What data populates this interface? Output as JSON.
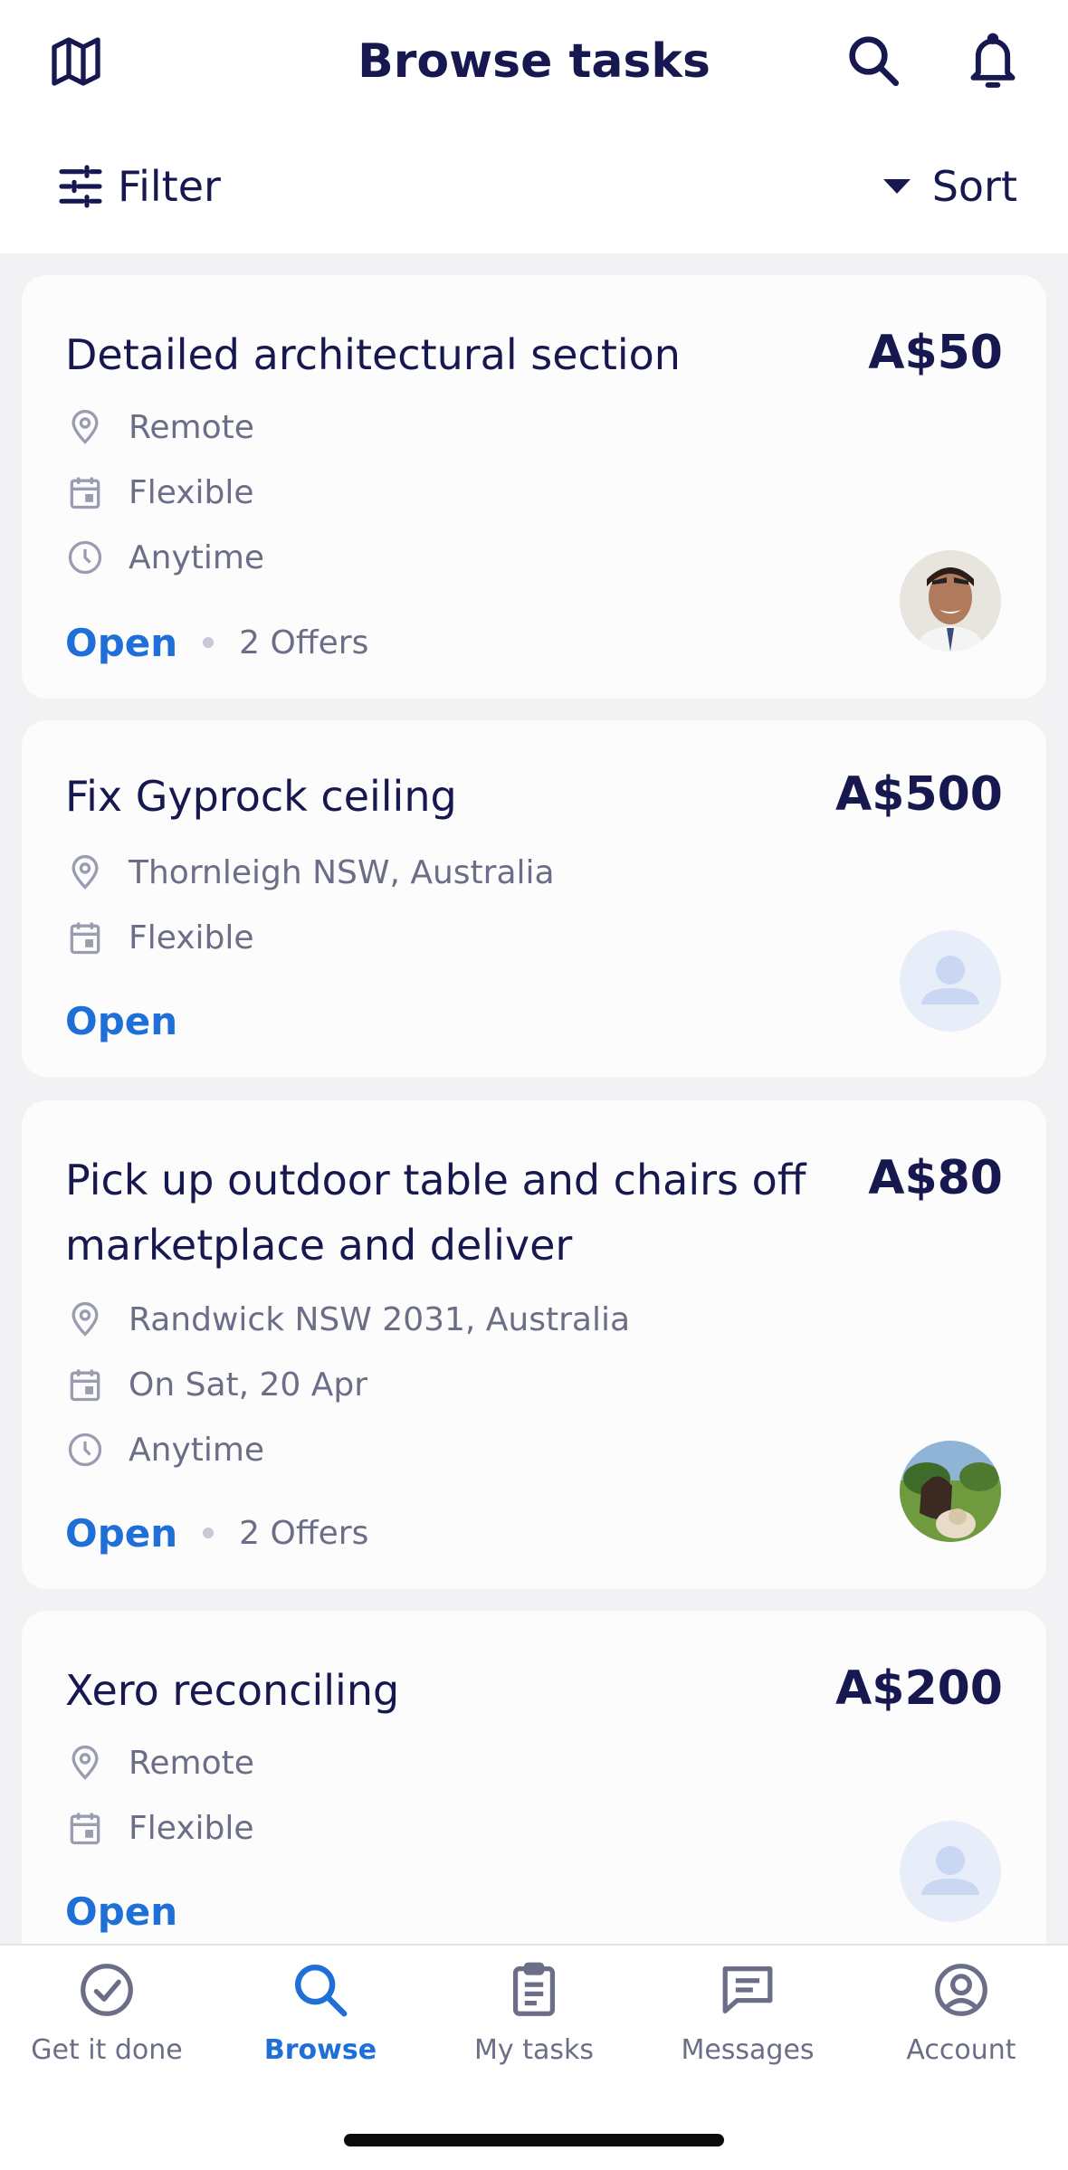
{
  "header": {
    "title": "Browse tasks",
    "filter_label": "Filter",
    "sort_label": "Sort"
  },
  "tasks": [
    {
      "title": "Detailed architectural section",
      "price": "A$50",
      "location": "Remote",
      "date": "Flexible",
      "time": "Anytime",
      "status": "Open",
      "offers": "2 Offers",
      "avatar": "photo"
    },
    {
      "title": "Fix Gyprock ceiling",
      "price": "A$500",
      "location": "Thornleigh NSW, Australia",
      "date": "Flexible",
      "status": "Open",
      "avatar": "placeholder"
    },
    {
      "title": "Pick up outdoor table and chairs off marketplace and deliver",
      "price": "A$80",
      "location": "Randwick NSW 2031, Australia",
      "date": "On Sat, 20 Apr",
      "time": "Anytime",
      "status": "Open",
      "offers": "2 Offers",
      "avatar": "photo"
    },
    {
      "title": "Xero reconciling",
      "price": "A$200",
      "location": "Remote",
      "date": "Flexible",
      "status": "Open",
      "avatar": "placeholder"
    }
  ],
  "tabbar": {
    "items": [
      {
        "label": "Get it done",
        "icon": "check-circle-icon",
        "active": false
      },
      {
        "label": "Browse",
        "icon": "search-icon",
        "active": true
      },
      {
        "label": "My tasks",
        "icon": "clipboard-icon",
        "active": false
      },
      {
        "label": "Messages",
        "icon": "message-icon",
        "active": false
      },
      {
        "label": "Account",
        "icon": "account-icon",
        "active": false
      }
    ]
  },
  "colors": {
    "navy": "#17184f",
    "accent": "#1f6fd8",
    "muted": "#6b6e86",
    "background": "#f2f2f4"
  }
}
